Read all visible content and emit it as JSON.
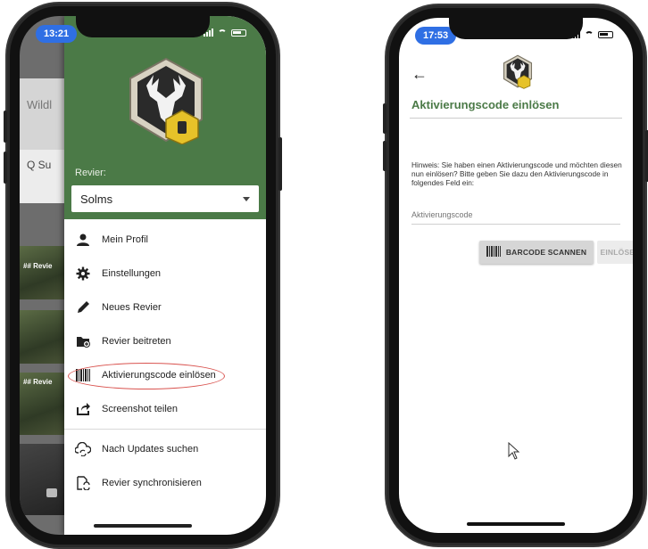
{
  "left_phone": {
    "status": {
      "time": "13:21"
    },
    "background_app": {
      "partial_texts": [
        "Wildl",
        "Q Su",
        "## Revie",
        "## Revie"
      ]
    },
    "drawer": {
      "header_color": "#4b7a47",
      "revier_label": "Revier:",
      "revier_select": "Solms",
      "menu": [
        {
          "label": "Mein Profil",
          "icon": "person-icon"
        },
        {
          "label": "Einstellungen",
          "icon": "gear-icon"
        },
        {
          "label": "Neues Revier",
          "icon": "pencil-icon"
        },
        {
          "label": "Revier beitreten",
          "icon": "folder-add-icon"
        },
        {
          "label": "Aktivierungscode einlösen",
          "icon": "barcode-icon",
          "highlighted": true
        },
        {
          "label": "Screenshot teilen",
          "icon": "share-icon"
        }
      ],
      "menu_secondary": [
        {
          "label": "Nach Updates suchen",
          "icon": "cloud-sync-icon"
        },
        {
          "label": "Revier synchronisieren",
          "icon": "sync-file-icon"
        }
      ]
    }
  },
  "right_phone": {
    "status": {
      "time": "17:53"
    },
    "title": "Aktivierungscode einlösen",
    "hint": "Hinweis: Sie haben einen Aktivierungscode und möchten diesen nun einlösen? Bitte geben Sie dazu den Aktivierungscode in folgendes Feld ein:",
    "input_placeholder": "Aktivierungscode",
    "scan_button": "BARCODE SCANNEN",
    "redeem_button": "EINLÖSEN",
    "accent_color": "#4b7a47"
  }
}
